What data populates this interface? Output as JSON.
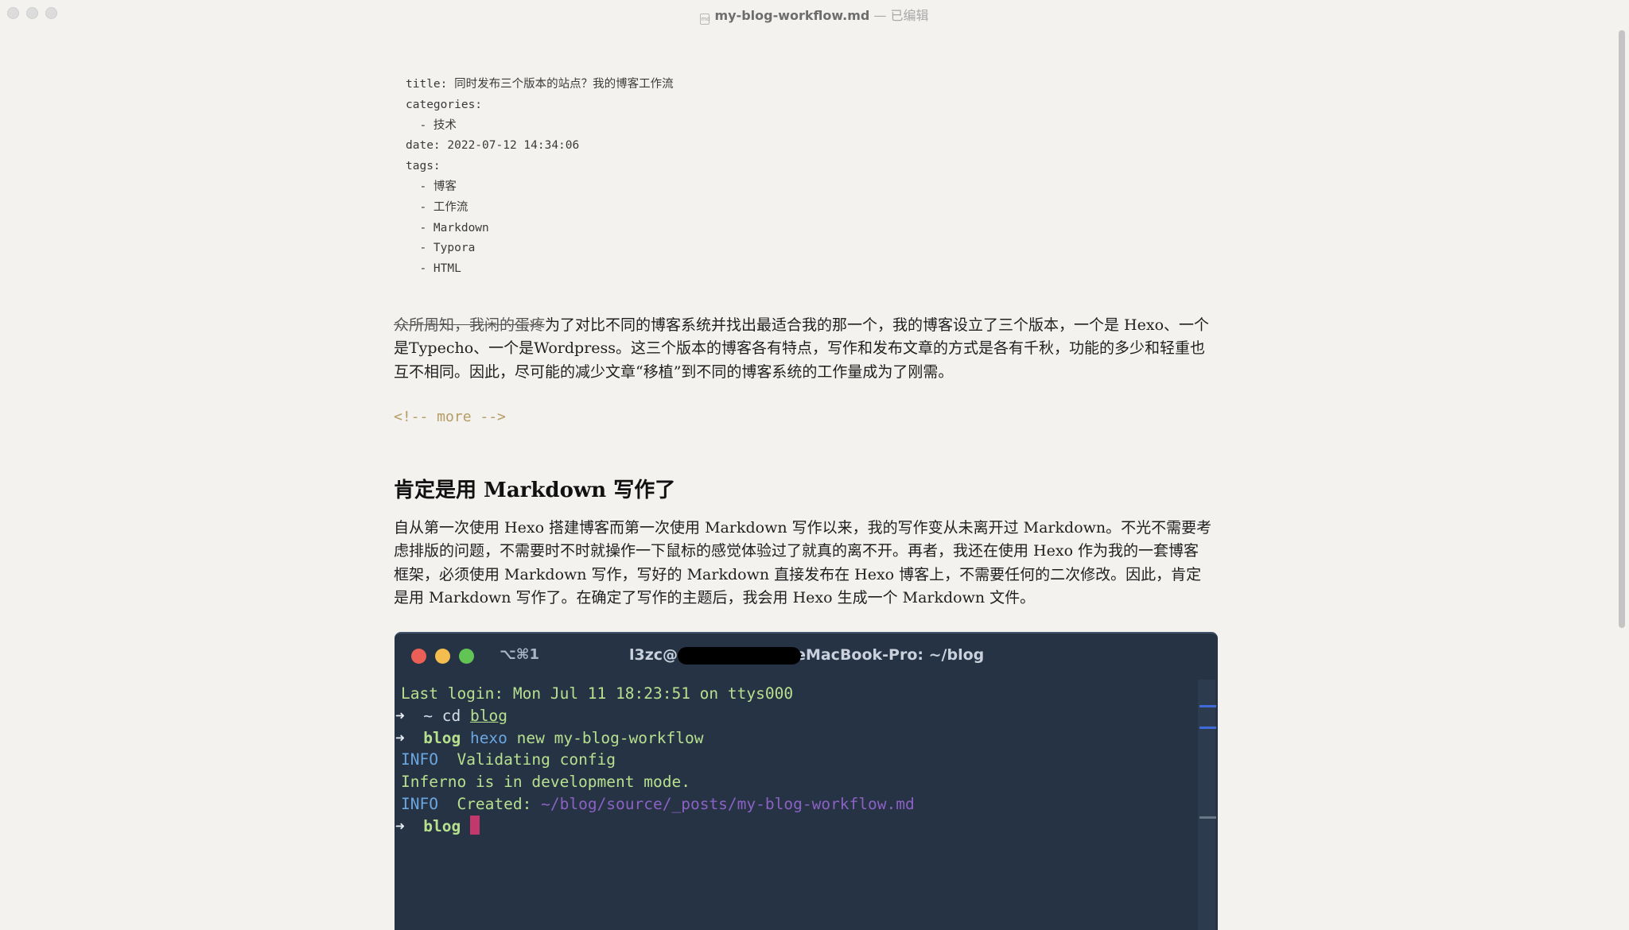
{
  "window": {
    "filename": "my-blog-workflow.md",
    "separator": " — ",
    "status": "已编辑",
    "file_icon": "md"
  },
  "front_matter": [
    "title: 同时发布三个版本的站点？我的博客工作流",
    "categories:",
    "  - 技术",
    "date: 2022-07-12 14:34:06",
    "tags:",
    "  - 博客",
    "  - 工作流",
    "  - Markdown",
    "  - Typora",
    "  - HTML"
  ],
  "intro": {
    "strike": "众所周知，我闲的蛋疼",
    "text": "为了对比不同的博客系统并找出最适合我的那一个，我的博客设立了三个版本，一个是 Hexo、一个 是Typecho、一个是Wordpress。这三个版本的博客各有特点，写作和发布文章的方式是各有千秋，功能的多少和轻重也互不相同。因此，尽可能的减少文章“移植”到不同的博客系统的工作量成为了刚需。"
  },
  "more_comment": "<!-- more -->",
  "section": {
    "heading": "肯定是用 Markdown 写作了",
    "paragraph": "自从第一次使用 Hexo 搭建博客而第一次使用 Markdown 写作以来，我的写作变从未离开过 Markdown。不光不需要考虑排版的问题，不需要时不时就操作一下鼠标的感觉体验过了就真的离不开。再者，我还在使用 Hexo 作为我的一套博客框架，必须使用 Markdown 写作，写好的 Markdown 直接发布在 Hexo 博客上，不需要任何的二次修改。因此，肯定是用 Markdown 写作了。在确定了写作的主题后，我会用 Hexo 生成一个 Markdown 文件。"
  },
  "terminal": {
    "tab_key": "⌥⌘1",
    "title_left": "l3zc@",
    "title_right": "eMacBook-Pro: ~/blog",
    "prompt_arrow": "➜",
    "last_login": "Last login: Mon Jul 11 18:23:51 on ttys000",
    "line1_dir": "~",
    "line1_cmd": "cd",
    "line1_arg": "blog",
    "line2_dir": "blog",
    "line2_cmd": "hexo",
    "line2_args": "new my-blog-workflow",
    "info_label": "INFO",
    "info1": "Validating config",
    "inferno": "Inferno is in development mode.",
    "info2_label": "Created:",
    "info2_path": "~/blog/source/_posts/my-blog-workflow.md",
    "line3_dir": "blog"
  },
  "colors": {
    "background": "#f3f2ef",
    "terminal_bg": "#263345",
    "close": "#ec5f57",
    "minimize": "#f4be4f",
    "zoom": "#61c454",
    "comment": "#b49c63"
  }
}
